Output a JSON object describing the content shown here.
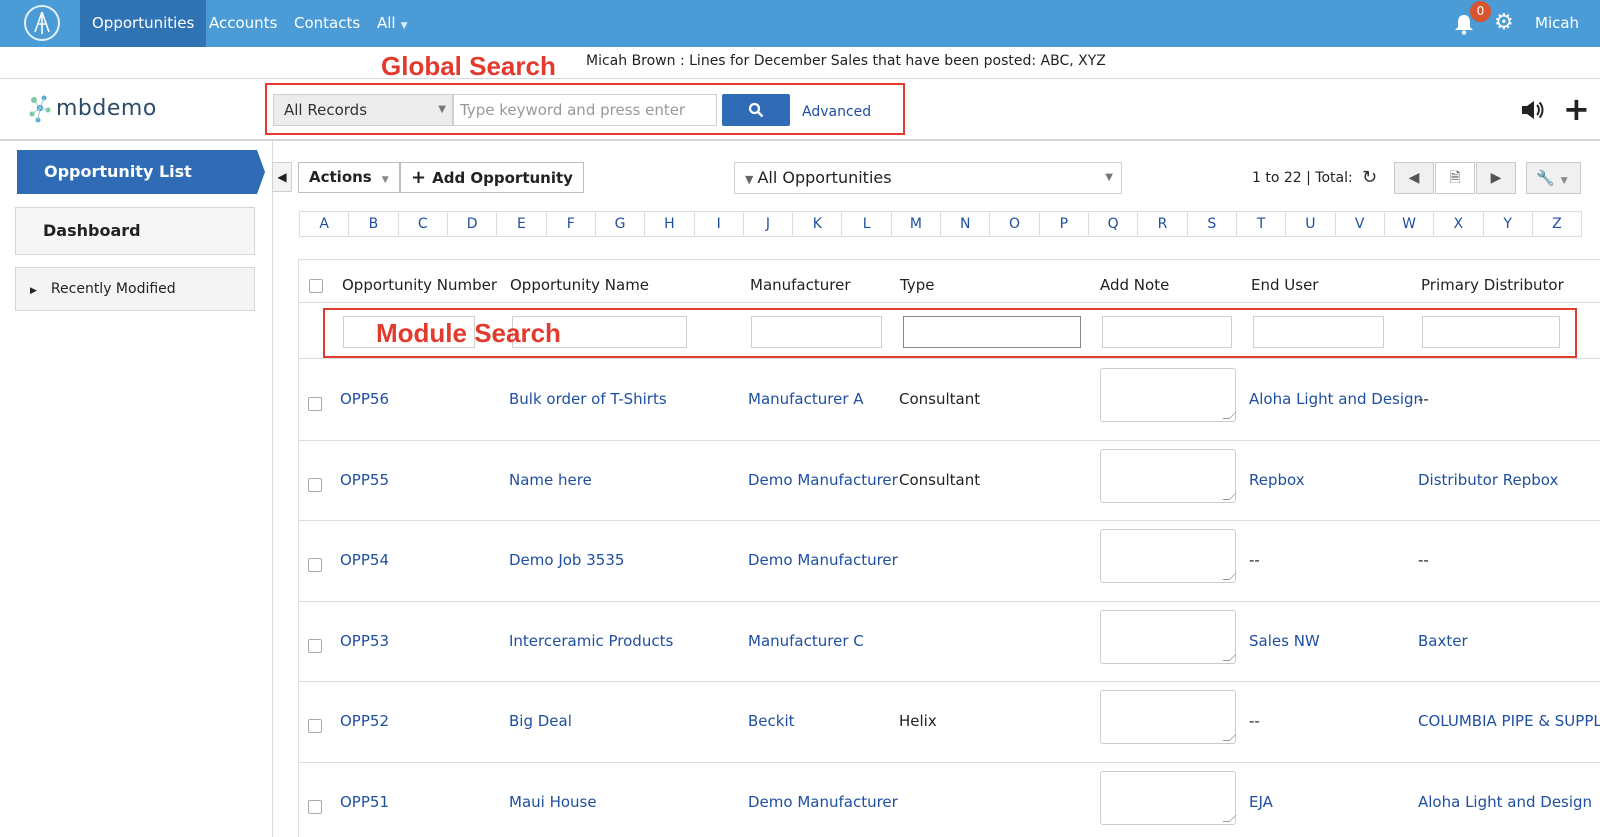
{
  "nav": {
    "tabs": [
      {
        "label": "Opportunities"
      },
      {
        "label": "Accounts"
      },
      {
        "label": "Contacts"
      },
      {
        "label": "All"
      }
    ],
    "notification_count": "0",
    "user": "Micah"
  },
  "announcement": "Micah Brown : Lines for December Sales that have been posted: ABC, XYZ",
  "annotations": {
    "global_search": "Global Search",
    "module_search": "Module Search"
  },
  "brand": {
    "name": "mbdemo"
  },
  "search": {
    "scope": "All Records",
    "placeholder": "Type keyword and press enter",
    "advanced": "Advanced"
  },
  "sidebar": {
    "active": "Opportunity List",
    "dashboard": "Dashboard",
    "recent": "Recently Modified"
  },
  "toolbar": {
    "actions": "Actions",
    "add": "Add Opportunity",
    "filter": "All Opportunities",
    "pager": "1 to 22 | Total:"
  },
  "alphabet": [
    "A",
    "B",
    "C",
    "D",
    "E",
    "F",
    "G",
    "H",
    "I",
    "J",
    "K",
    "L",
    "M",
    "N",
    "O",
    "P",
    "Q",
    "R",
    "S",
    "T",
    "U",
    "V",
    "W",
    "X",
    "Y",
    "Z"
  ],
  "table": {
    "columns": [
      "Opportunity Number",
      "Opportunity Name",
      "Manufacturer",
      "Type",
      "Add Note",
      "End User",
      "Primary Distributor"
    ],
    "rows": [
      {
        "number": "OPP56",
        "name": "Bulk order of T-Shirts",
        "manufacturer": "Manufacturer A",
        "type": "Consultant",
        "end_user": "Aloha Light and Design",
        "distributor": "--"
      },
      {
        "number": "OPP55",
        "name": "Name here",
        "manufacturer": "Demo Manufacturer",
        "type": "Consultant",
        "end_user": "Repbox",
        "distributor": "Distributor Repbox"
      },
      {
        "number": "OPP54",
        "name": "Demo Job 3535",
        "manufacturer": "Demo Manufacturer",
        "type": "",
        "end_user": "--",
        "distributor": "--"
      },
      {
        "number": "OPP53",
        "name": "Interceramic Products",
        "manufacturer": "Manufacturer C",
        "type": "",
        "end_user": "Sales NW",
        "distributor": "Baxter"
      },
      {
        "number": "OPP52",
        "name": "Big Deal",
        "manufacturer": "Beckit",
        "type": "Helix",
        "end_user": "--",
        "distributor": "COLUMBIA PIPE & SUPPL"
      },
      {
        "number": "OPP51",
        "name": "Maui House",
        "manufacturer": "Demo Manufacturer",
        "type": "",
        "end_user": "EJA",
        "distributor": "Aloha Light and Design"
      }
    ]
  },
  "colors": {
    "nav": "#4a9bd6",
    "nav_active": "#2f73b5",
    "primary": "#2f6cb5",
    "link": "#1f4fa0",
    "annotation": "#e23b2e",
    "badge": "#d9532e"
  }
}
